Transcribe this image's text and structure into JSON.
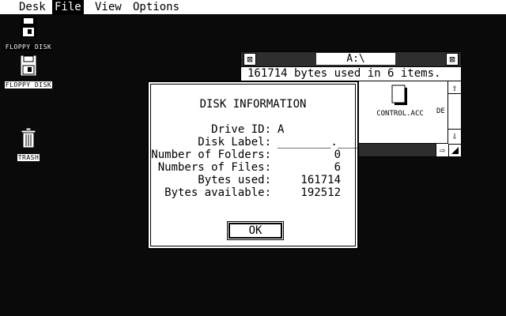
{
  "menubar": {
    "items": [
      "Desk",
      "File",
      "View",
      "Options"
    ],
    "active": "File"
  },
  "desktop": {
    "icons": [
      {
        "label": "FLOPPY DISK",
        "icon": "floppy-disk-icon",
        "selected": true
      },
      {
        "label": "FLOPPY DISK",
        "icon": "floppy-disk-icon",
        "selected": false
      },
      {
        "label": "TRASH",
        "icon": "trash-icon",
        "selected": false
      }
    ]
  },
  "window": {
    "title": "A:\\",
    "info": "161714 bytes used in 6 items.",
    "close_glyph": "⊠",
    "full_glyph": "⊠",
    "scroll_up": "⇧",
    "scroll_down": "⇩",
    "scroll_right": "⇨",
    "files": [
      {
        "label": "CONTROL.ACC",
        "icon": "file-icon"
      },
      {
        "label": "DE",
        "icon": "file-icon"
      }
    ]
  },
  "dialog": {
    "title": "DISK INFORMATION",
    "rows": {
      "drive_id": {
        "label": "Drive ID:",
        "value": "A"
      },
      "disk_label": {
        "label": "Disk Label:",
        "value": "________.___"
      },
      "folders": {
        "label": "Number of Folders:",
        "value": "0"
      },
      "files": {
        "label": "Numbers of Files:",
        "value": "6"
      },
      "bytes_used": {
        "label": "Bytes used:",
        "value": "161714"
      },
      "bytes_available": {
        "label": "Bytes available:",
        "value": "192512"
      }
    },
    "ok_label": "OK"
  }
}
